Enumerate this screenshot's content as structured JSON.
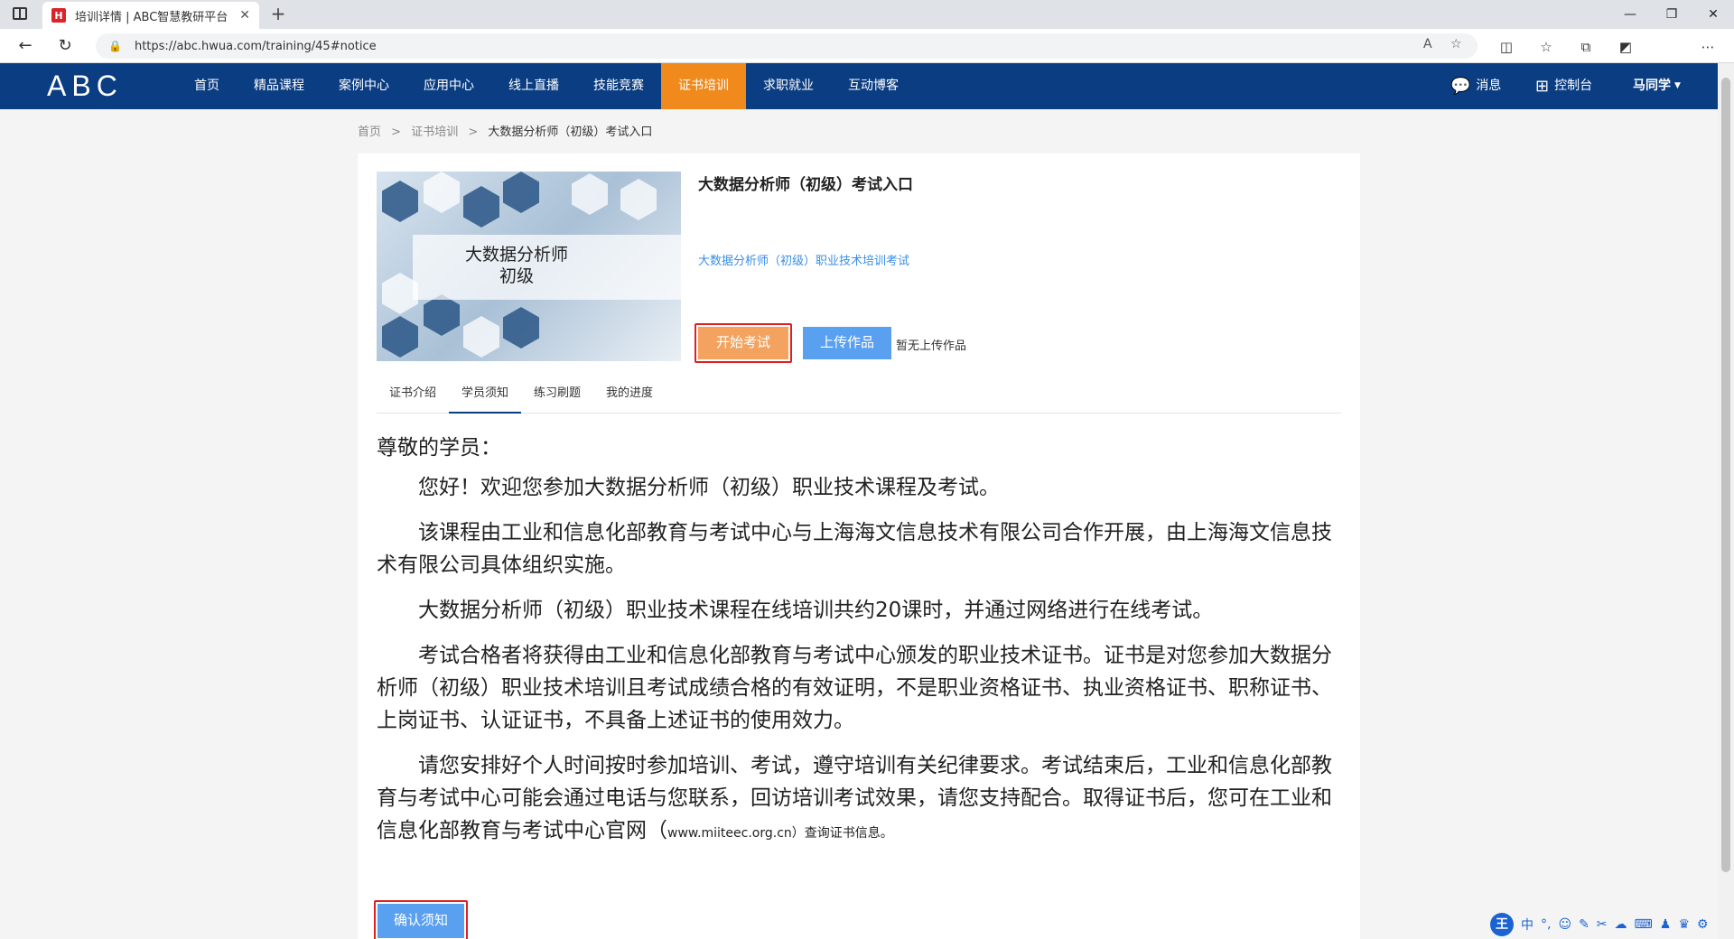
{
  "browser": {
    "tab_title": "培训详情 | ABC智慧教研平台",
    "tab_favicon": "H",
    "url": "https://abc.hwua.com/training/45#notice"
  },
  "site": {
    "logo": "ABC",
    "nav": [
      "首页",
      "精品课程",
      "案例中心",
      "应用中心",
      "线上直播",
      "技能竞赛",
      "证书培训",
      "求职就业",
      "互动博客"
    ],
    "active_nav": "证书培训",
    "messages_label": "消息",
    "console_label": "控制台",
    "user_name": "马同学"
  },
  "breadcrumb": {
    "home": "首页",
    "section": "证书培训",
    "current": "大数据分析师（初级）考试入口"
  },
  "course": {
    "cover_text_line1": "大数据分析师",
    "cover_text_line2": "初级",
    "title": "大数据分析师（初级）考试入口",
    "subtitle": "大数据分析师（初级）职业技术培训考试",
    "start_exam_label": "开始考试",
    "upload_label": "上传作品",
    "no_upload_text": "暂无上传作品"
  },
  "tabs": [
    "证书介绍",
    "学员须知",
    "练习刷题",
    "我的进度"
  ],
  "active_tab": "学员须知",
  "notice": {
    "greeting": "尊敬的学员：",
    "p1": "您好！欢迎您参加大数据分析师（初级）职业技术课程及考试。",
    "p2": "该课程由工业和信息化部教育与考试中心与上海海文信息技术有限公司合作开展，由上海海文信息技术有限公司具体组织实施。",
    "p3": "大数据分析师（初级）职业技术课程在线培训共约20课时，并通过网络进行在线考试。",
    "p4": "考试合格者将获得由工业和信息化部教育与考试中心颁发的职业技术证书。证书是对您参加大数据分析师（初级）职业技术培训且考试成绩合格的有效证明，不是职业资格证书、执业资格证书、职称证书、上岗证书、认证证书，不具备上述证书的使用效力。",
    "p5_main": "请您安排好个人时间按时参加培训、考试，遵守培训有关纪律要求。考试结束后，工业和信息化部教育与考试中心可能会通过电话与您联系，回访培训考试效果，请您支持配合。取得证书后，您可在工业和信息化部教育与考试中心官网（",
    "p5_small": "www.miiteec.org.cn）查询证书信息。",
    "confirm_label": "确认须知"
  },
  "ime": {
    "logo": "王",
    "mode": "中"
  },
  "colors": {
    "header_bg": "#0b3d82",
    "nav_active": "#f08a1d",
    "start_btn": "#f3a35f",
    "upload_btn": "#5aa0f0",
    "highlight_frame": "#e02020",
    "link_blue": "#3a8ee6"
  }
}
